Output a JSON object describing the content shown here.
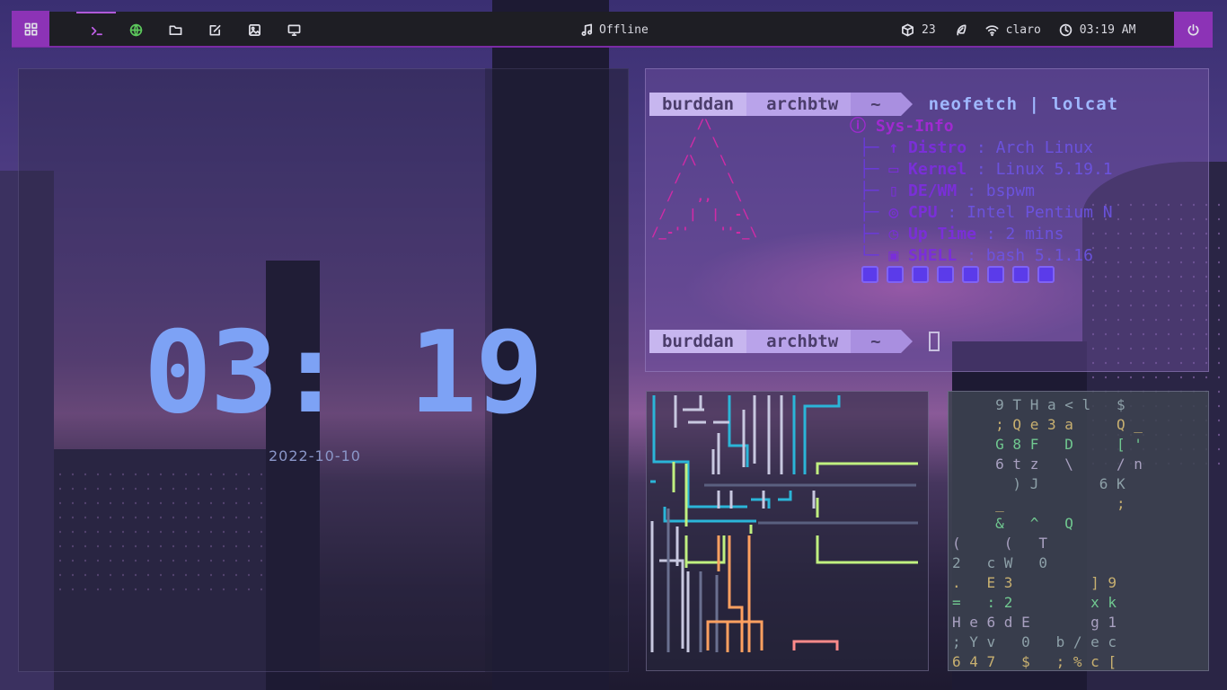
{
  "topbar": {
    "apps_icon": "grid-icon",
    "workspaces": [
      {
        "icon": "terminal-icon",
        "color": "#c060e8",
        "active": true
      },
      {
        "icon": "globe-icon",
        "color": "#5cc85c",
        "active": false
      },
      {
        "icon": "folder-icon",
        "color": "#e0e0e8",
        "active": false
      },
      {
        "icon": "edit-icon",
        "color": "#e0e0e8",
        "active": false
      },
      {
        "icon": "image-icon",
        "color": "#e0e0e8",
        "active": false
      },
      {
        "icon": "monitor-icon",
        "color": "#e0e0e8",
        "active": false
      }
    ],
    "music_icon": "music-note-icon",
    "music_status": "Offline",
    "updates_icon": "package-icon",
    "updates_count": "23",
    "feather_icon": "feather-icon",
    "wifi_icon": "wifi-icon",
    "wifi_network": "claro",
    "clock_icon": "clock-icon",
    "time": "03:19 AM",
    "power_icon": "power-icon",
    "accent": "#8c33b6"
  },
  "clock_widget": {
    "time": "03: 19",
    "date": "2022-10-10",
    "color": "#7da2f5"
  },
  "terminal": {
    "prompt_user": "burddan",
    "prompt_host": "archbtw",
    "prompt_dir": "~",
    "command": "neofetch | lolcat",
    "ascii_art": "      /\\\n     /  \\\n    /\\   \\\n   /      \\\n  /   ,,   \\\n /   |  |  -\\\n/_-''    ''-_\\",
    "sysinfo": {
      "header": "Sys-Info",
      "rows": [
        {
          "icon": "arrow-up-icon",
          "glyph": "↑",
          "key": "Distro",
          "value": "Arch Linux"
        },
        {
          "icon": "memory-icon",
          "glyph": "▭",
          "key": "Kernel",
          "value": "Linux 5.19.1"
        },
        {
          "icon": "phone-icon",
          "glyph": "▯",
          "key": "DE/WM",
          "value": "bspwm"
        },
        {
          "icon": "cpu-icon",
          "glyph": "◎",
          "key": "CPU",
          "value": "Intel Pentium N"
        },
        {
          "icon": "clock-icon",
          "glyph": "◷",
          "key": "Up Time",
          "value": "2 mins"
        },
        {
          "icon": "monitor-icon",
          "glyph": "▣",
          "key": "SHELL",
          "value": "bash 5.1.16"
        }
      ]
    },
    "color_blocks": 8
  },
  "matrix_rows": [
    "     9 T H a < l   $",
    "     ; Q e 3 a     Q _",
    "     G 8 F   D     [ '",
    "     6 t z   \\     / n",
    "       ) J       6 K",
    "     _             ;",
    "     &   ^   Q",
    "(     (   T",
    "2   c W   0",
    ".   E 3         ] 9",
    "=   : 2         x k",
    "H e 6 d E       g 1",
    "; Y v   0   b / e c",
    "6 4 7   $   ; % c ["
  ]
}
